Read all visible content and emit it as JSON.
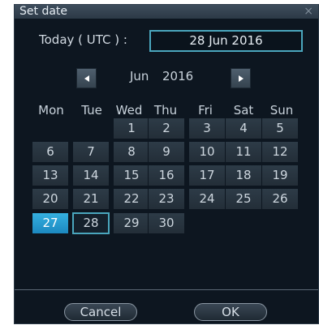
{
  "dialog": {
    "title": "Set date",
    "close_icon": "×"
  },
  "today": {
    "label": "Today ( UTC ) :",
    "value": "28 Jun 2016"
  },
  "navigation": {
    "prev_icon": "left-triangle",
    "next_icon": "right-triangle",
    "month": "Jun",
    "year": "2016"
  },
  "weekdays": [
    "Mon",
    "Tue",
    "Wed",
    "Thu",
    "Fri",
    "Sat",
    "Sun"
  ],
  "days": [
    "1",
    "2",
    "3",
    "4",
    "5",
    "6",
    "7",
    "8",
    "9",
    "10",
    "11",
    "12",
    "13",
    "14",
    "15",
    "16",
    "17",
    "18",
    "19",
    "20",
    "21",
    "22",
    "23",
    "24",
    "25",
    "26",
    "27",
    "28",
    "29",
    "30"
  ],
  "selected_day": "27",
  "today_day": "28",
  "buttons": {
    "cancel": "Cancel",
    "ok": "OK"
  },
  "colors": {
    "background": "#0d1620",
    "accent": "#4aa6bd",
    "selected": "#2a9fd4"
  }
}
